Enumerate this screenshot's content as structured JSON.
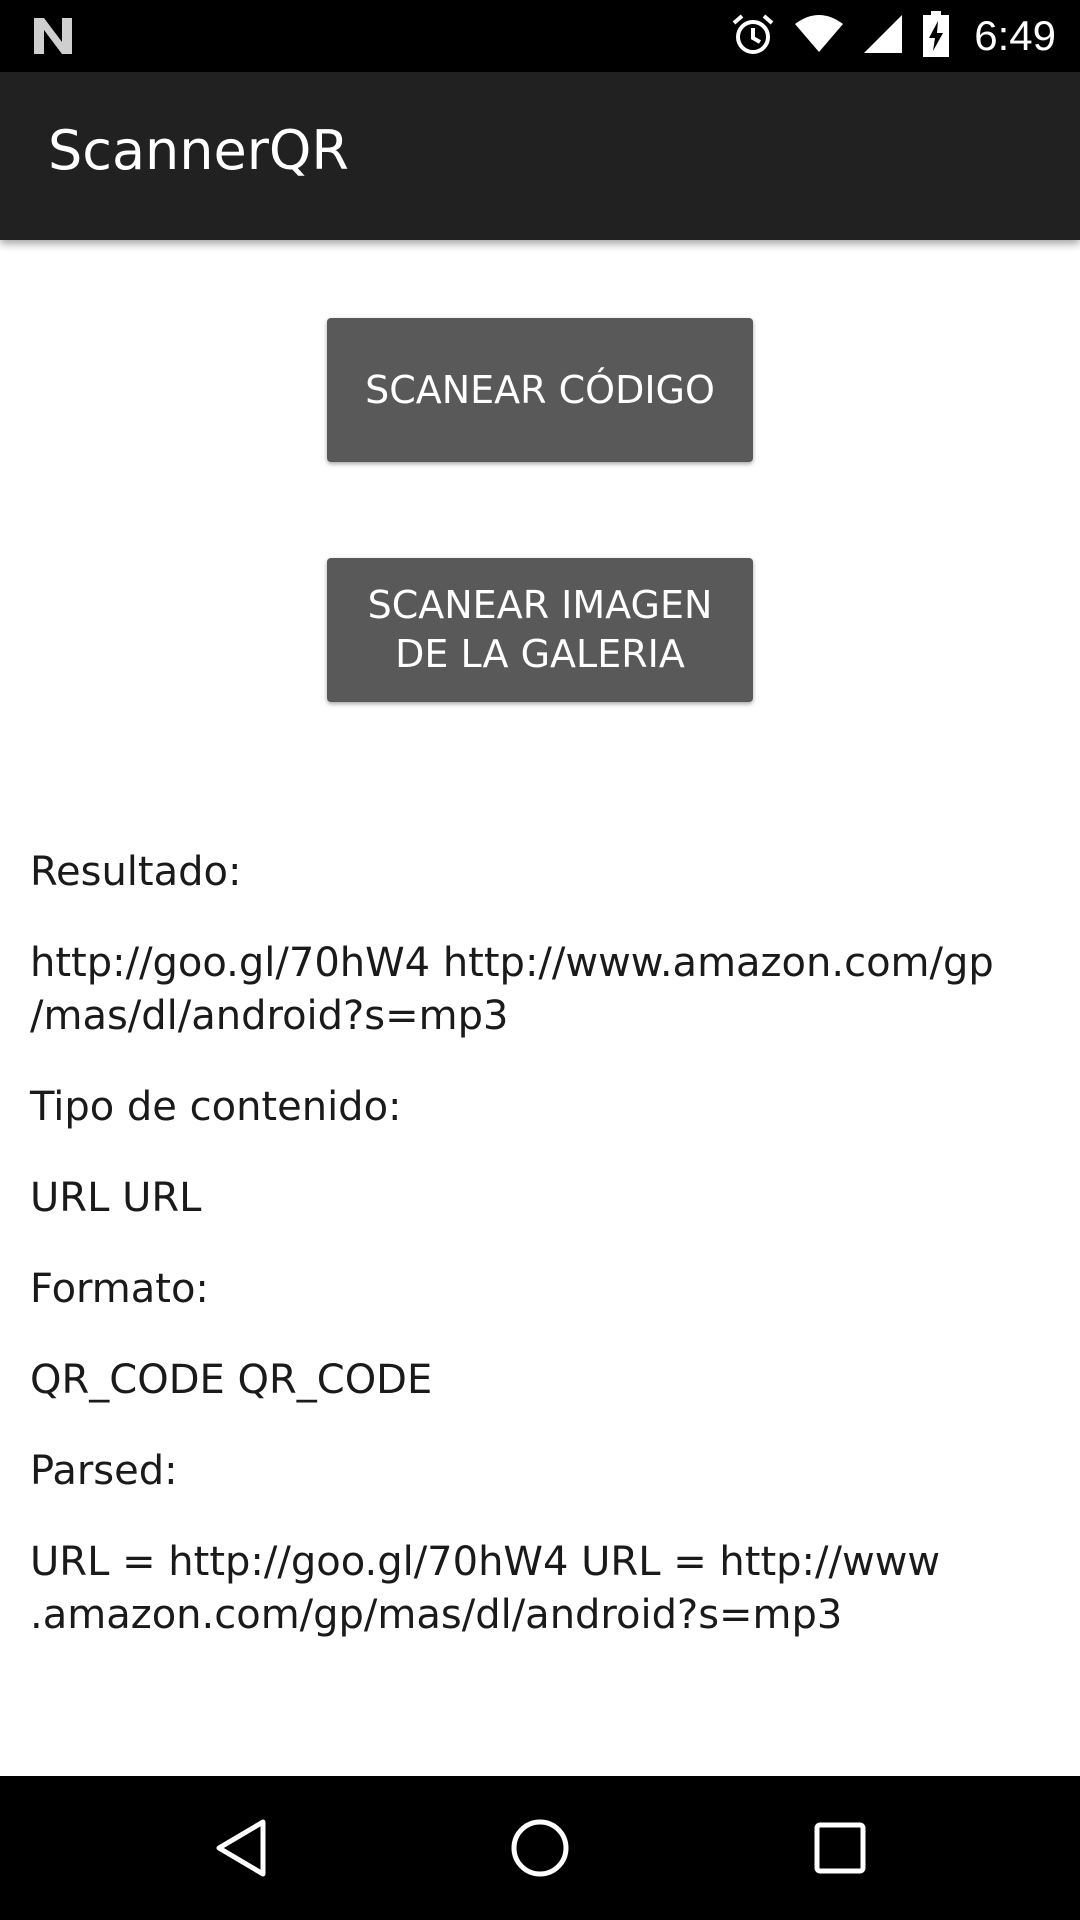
{
  "status_bar": {
    "time": "6:49",
    "icons": [
      "notification-n-icon",
      "alarm-icon",
      "wifi-icon",
      "signal-icon",
      "battery-charging-icon"
    ]
  },
  "app_bar": {
    "title": "ScannerQR"
  },
  "buttons": {
    "scan_code_label": "SCANEAR CÓDIGO",
    "scan_gallery_label": "SCANEAR IMAGEN\nDE LA GALERIA"
  },
  "results": {
    "result_label": "Resultado:",
    "result_value": " http://goo.gl/70hW4 http://www.amazon.com/gp\n/mas/dl/android?s=mp3",
    "content_type_label": "Tipo de contenido:",
    "content_type_value": " URL URL",
    "format_label": "Formato:",
    "format_value": " QR_CODE QR_CODE",
    "parsed_label": "Parsed:",
    "parsed_value": " URL = http://goo.gl/70hW4 URL = http://www\n.amazon.com/gp/mas/dl/android?s=mp3"
  },
  "nav_bar": {
    "icons": [
      "back-icon",
      "home-icon",
      "recent-apps-icon"
    ]
  },
  "colors": {
    "status_bar": "#000000",
    "app_bar": "#212121",
    "button": "#595959",
    "text": "#1a1a1a",
    "nav_bar": "#000000"
  }
}
